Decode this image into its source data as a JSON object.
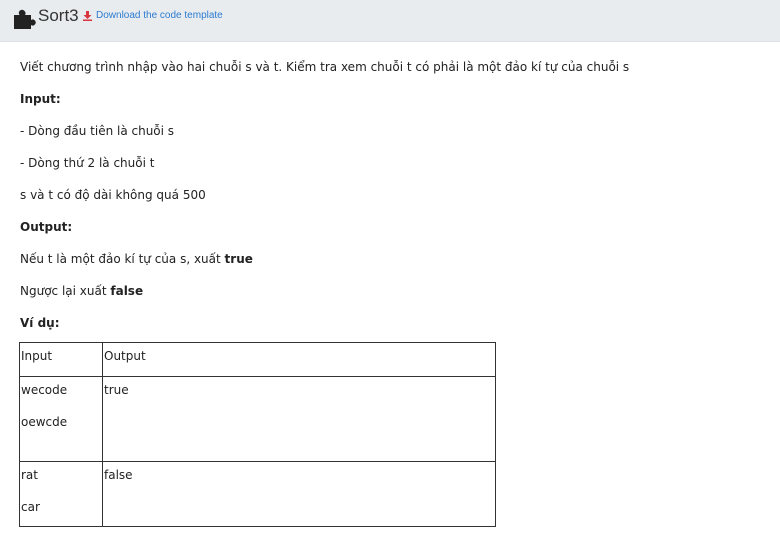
{
  "header": {
    "title": "Sort3",
    "download_label": "Download the code template",
    "download_icon": "download-icon",
    "logo_icon": "puzzle-icon",
    "download_color": "#2b7bd0",
    "download_icon_color": "#d9363e"
  },
  "problem": {
    "statement": "Viết chương trình nhập vào hai chuỗi s và t. Kiểm tra xem chuỗi t có phải là một đảo kí tự của chuỗi s",
    "input_heading": "Input:",
    "input_line1": "- Dòng đầu tiên là chuỗi s",
    "input_line2": "- Dòng thứ 2 là chuỗi t",
    "constraint": "s và t có độ dài không quá 500",
    "output_heading": "Output:",
    "output_true_prefix": "Nếu t là một đảo kí tự của s, xuất ",
    "output_true_value": "true",
    "output_false_prefix": "Ngược lại xuất ",
    "output_false_value": "false",
    "example_heading": "Ví dụ:"
  },
  "example_table": {
    "headers": [
      "Input",
      "Output"
    ],
    "rows": [
      {
        "input_line1": "wecode",
        "input_line2": "oewcde",
        "output": "true"
      },
      {
        "input_line1": "rat",
        "input_line2": "car",
        "output": "false"
      }
    ]
  }
}
